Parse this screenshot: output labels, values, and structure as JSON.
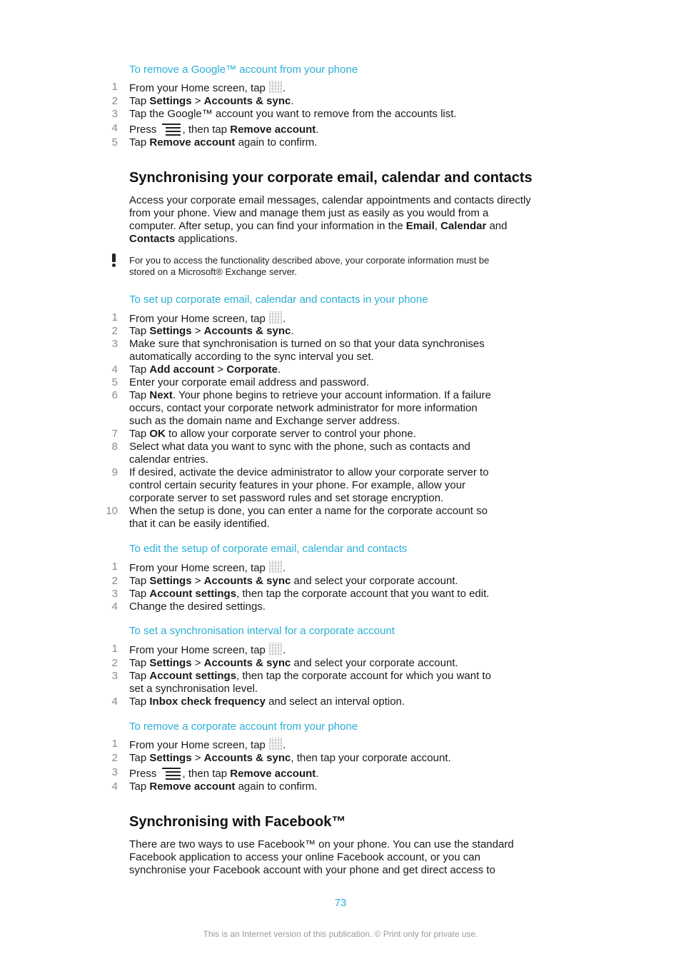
{
  "sections": {
    "remove_google": {
      "title": "To remove a Google™ account from your phone",
      "steps": [
        {
          "n": "1",
          "pre": "From your Home screen, tap ",
          "icon": "apps-grid-icon",
          "post": "."
        },
        {
          "n": "2",
          "pre": "Tap ",
          "b1": "Settings",
          "mid": " > ",
          "b2": "Accounts & sync",
          "post": "."
        },
        {
          "n": "3",
          "pre": "Tap the Google™ account you want to remove from the accounts list."
        },
        {
          "n": "4",
          "pre": "Press ",
          "icon": "menu-icon",
          "mid": ", then tap ",
          "b1": "Remove account",
          "post": "."
        },
        {
          "n": "5",
          "pre": "Tap ",
          "b1": "Remove account",
          "post": " again to confirm."
        }
      ]
    },
    "corporate": {
      "heading": "Synchronising your corporate email, calendar and contacts",
      "intro_lines": [
        "Access your corporate email messages, calendar appointments and contacts directly",
        "from your phone. View and manage them just as easily as you would from a",
        "computer. After setup, you can find your information in the ",
        "applications."
      ],
      "intro_bold": [
        "Email",
        "Calendar",
        "Contacts"
      ],
      "intro_and": "and",
      "note_lines": [
        "For you to access the functionality described above, your corporate information must be",
        "stored on a Microsoft® Exchange server."
      ]
    },
    "setup": {
      "title": "To set up corporate email, calendar and contacts in your phone",
      "steps": [
        {
          "n": "1",
          "lines": [
            "From your Home screen, tap [grid]."
          ]
        },
        {
          "n": "2",
          "lines": [
            "Tap **Settings** > **Accounts & sync**."
          ]
        },
        {
          "n": "3",
          "lines": [
            "Make sure that synchronisation is turned on so that your data synchronises",
            "automatically according to the sync interval you set."
          ]
        },
        {
          "n": "4",
          "lines": [
            "Tap **Add account** > **Corporate**."
          ]
        },
        {
          "n": "5",
          "lines": [
            "Enter your corporate email address and password."
          ]
        },
        {
          "n": "6",
          "lines": [
            "Tap **Next**. Your phone begins to retrieve your account information. If a failure",
            "occurs, contact your corporate network administrator for more information",
            "such as the domain name and Exchange server address."
          ]
        },
        {
          "n": "7",
          "lines": [
            "Tap **OK** to allow your corporate server to control your phone."
          ]
        },
        {
          "n": "8",
          "lines": [
            "Select what data you want to sync with the phone, such as contacts and",
            "calendar entries."
          ]
        },
        {
          "n": "9",
          "lines": [
            "If desired, activate the device administrator to allow your corporate server to",
            "control certain security features in your phone. For example, allow your",
            "corporate server to set password rules and set storage encryption."
          ]
        },
        {
          "n": "10",
          "lines": [
            "When the setup is done, you can enter a name for the corporate account so",
            "that it can be easily identified."
          ]
        }
      ]
    },
    "edit": {
      "title": "To edit the setup of corporate email, calendar and contacts",
      "steps": [
        {
          "n": "1",
          "lines": [
            "From your Home screen, tap [grid]."
          ]
        },
        {
          "n": "2",
          "lines": [
            "Tap **Settings** > **Accounts & sync** and select your corporate account."
          ]
        },
        {
          "n": "3",
          "lines": [
            "Tap **Account settings**, then tap the corporate account that you want to edit."
          ]
        },
        {
          "n": "4",
          "lines": [
            "Change the desired settings."
          ]
        }
      ]
    },
    "interval": {
      "title": "To set a synchronisation interval for a corporate account",
      "steps": [
        {
          "n": "1",
          "lines": [
            "From your Home screen, tap [grid]."
          ]
        },
        {
          "n": "2",
          "lines": [
            "Tap **Settings** > **Accounts & sync** and select your corporate account."
          ]
        },
        {
          "n": "3",
          "lines": [
            "Tap **Account settings**, then tap the corporate account for which you want to",
            "set a synchronisation level."
          ]
        },
        {
          "n": "4",
          "lines": [
            "Tap **Inbox check frequency** and select an interval option."
          ]
        }
      ]
    },
    "remove_corporate": {
      "title": "To remove a corporate account from your phone",
      "steps": [
        {
          "n": "1",
          "lines": [
            "From your Home screen, tap [grid]."
          ]
        },
        {
          "n": "2",
          "lines": [
            "Tap **Settings** > **Accounts & sync**, then tap your corporate account."
          ]
        },
        {
          "n": "3",
          "lines": [
            "Press [menu], then tap **Remove account**."
          ]
        },
        {
          "n": "4",
          "lines": [
            "Tap **Remove account** again to confirm."
          ]
        }
      ]
    },
    "facebook": {
      "heading": "Synchronising with Facebook™",
      "intro_lines": [
        "There are two ways to use Facebook™ on your phone. You can use the standard",
        "Facebook application to access your online Facebook account, or you can",
        "synchronise your Facebook account with your phone and get direct access to"
      ]
    }
  },
  "page_number": "73",
  "footer": "This is an Internet version of this publication. © Print only for private use.",
  "colors": {
    "accent": "#2aaed6",
    "text": "#1a1a1a",
    "number": "#8a8a8a",
    "footer": "#9a9a9a"
  }
}
